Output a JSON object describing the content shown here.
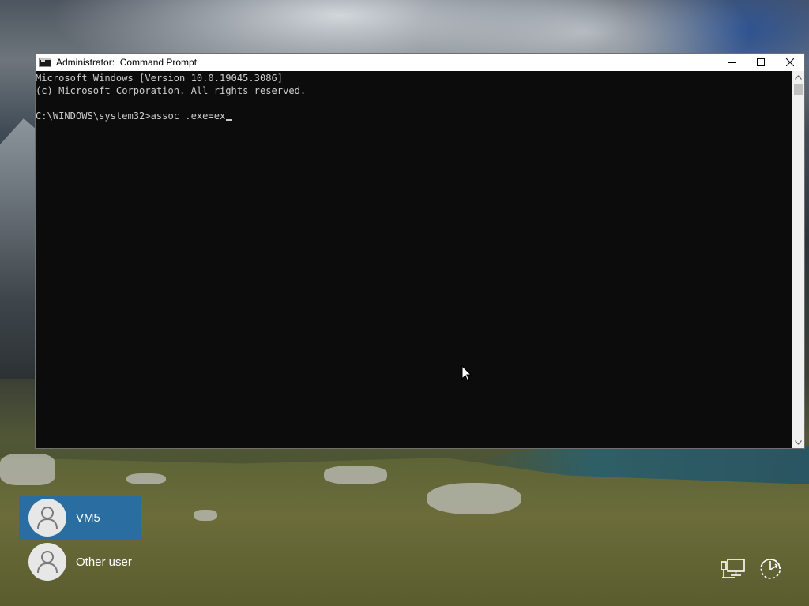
{
  "window": {
    "title": "Administrator:  Command Prompt",
    "controls": {
      "minimize_icon": "minimize-icon",
      "maximize_icon": "maximize-icon",
      "close_icon": "close-icon"
    }
  },
  "console": {
    "lines": [
      "Microsoft Windows [Version 10.0.19045.3086]",
      "(c) Microsoft Corporation. All rights reserved.",
      "",
      "C:\\WINDOWS\\system32>assoc .exe=ex"
    ],
    "text_color": "#cccccc",
    "background_color": "#0c0c0c"
  },
  "users": [
    {
      "name": "VM5",
      "selected": true
    },
    {
      "name": "Other user",
      "selected": false
    }
  ],
  "corner_icons": {
    "network": "network-icon",
    "ease_of_access": "ease-of-access-icon",
    "power": "power-icon"
  },
  "colors": {
    "selected_user_tile": "#246eaa",
    "titlebar": "#ffffff"
  }
}
